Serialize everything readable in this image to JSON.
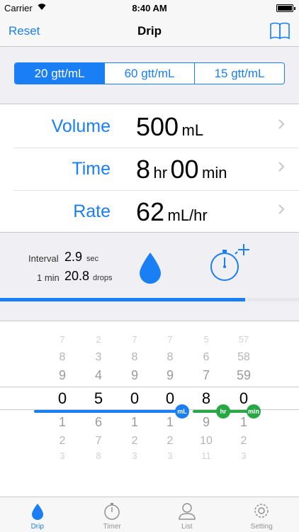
{
  "status_bar": {
    "carrier": "Carrier",
    "time": "8:40 AM"
  },
  "nav": {
    "left_button": "Reset",
    "title": "Drip",
    "right_icon": "book-icon"
  },
  "drop_factor": {
    "options": [
      "20 gtt/mL",
      "60 gtt/mL",
      "15 gtt/mL"
    ],
    "selected": "20 gtt/mL"
  },
  "rows": {
    "volume": {
      "label": "Volume",
      "value": "500",
      "unit": "mL"
    },
    "time": {
      "label": "Time",
      "hours": "8",
      "hours_unit": "hr",
      "minutes": "00",
      "minutes_unit": "min"
    },
    "rate": {
      "label": "Rate",
      "value": "62",
      "unit": "mL/hr"
    }
  },
  "info": {
    "interval_label": "Interval",
    "interval_value": "2.9",
    "interval_unit": "sec",
    "min_label": "1 min",
    "min_value": "20.8",
    "min_unit": "drops",
    "drop_icon": "drop-icon",
    "timer_icon": "stopwatch-add-icon"
  },
  "progress": {
    "fraction": 0.82
  },
  "picker": {
    "columns": [
      {
        "above": [
          "7",
          "8",
          "9"
        ],
        "selected": "0",
        "below": [
          "1",
          "2",
          "3"
        ]
      },
      {
        "above": [
          "2",
          "3",
          "4"
        ],
        "selected": "5",
        "below": [
          "6",
          "7",
          "8"
        ]
      },
      {
        "above": [
          "7",
          "8",
          "9"
        ],
        "selected": "0",
        "below": [
          "1",
          "2",
          "3"
        ]
      },
      {
        "above": [
          "7",
          "8",
          "9"
        ],
        "selected": "0",
        "below": [
          "1",
          "2",
          "3"
        ]
      },
      {
        "above": [
          "5",
          "6",
          "7"
        ],
        "selected": "8",
        "below": [
          "9",
          "10",
          "11"
        ]
      },
      {
        "above": [
          "57",
          "58",
          "59"
        ],
        "selected": "0",
        "below": [
          "1",
          "2",
          "3"
        ]
      }
    ],
    "badges": {
      "ml": "mL",
      "hr": "hr",
      "min": "min"
    }
  },
  "tabs": [
    {
      "label": "Drip",
      "icon": "drop-icon",
      "active": true
    },
    {
      "label": "Timer",
      "icon": "stopwatch-icon",
      "active": false
    },
    {
      "label": "List",
      "icon": "person-icon",
      "active": false
    },
    {
      "label": "Setting",
      "icon": "gear-icon",
      "active": false
    }
  ],
  "colors": {
    "accent": "#1a7ff5",
    "green": "#28a745",
    "background": "#efeff4"
  }
}
